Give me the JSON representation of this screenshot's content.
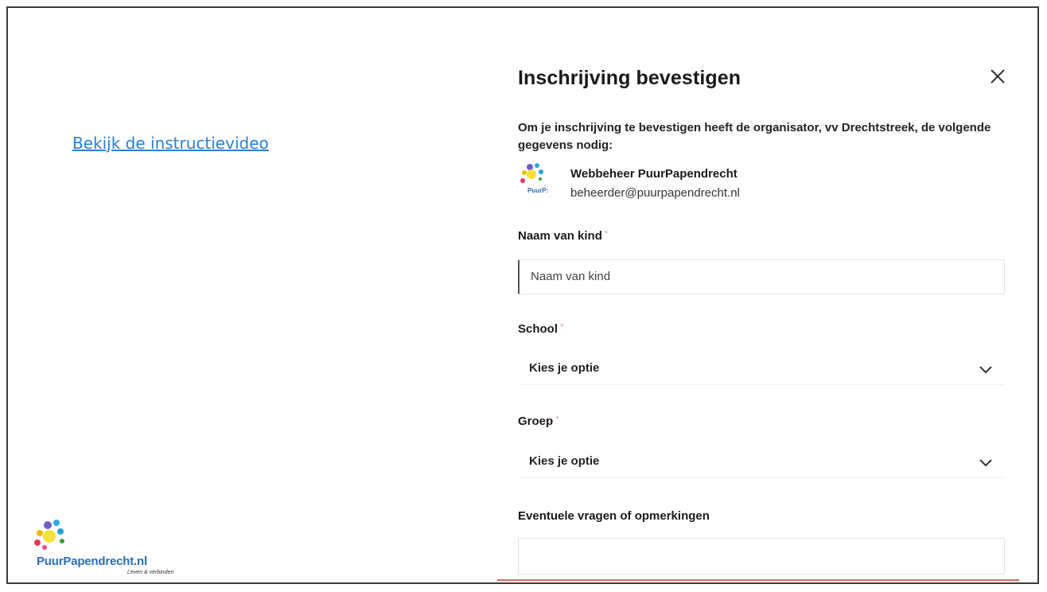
{
  "left": {
    "video_link": "Bekijk de instructievideo",
    "logo_text": "PuurPapendrecht.nl",
    "logo_tagline": "Leven & verbinden"
  },
  "modal": {
    "title": "Inschrijving bevestigen",
    "intro": "Om je inschrijving te bevestigen heeft de organisator, vv Drechtstreek, de volgende gegevens nodig:",
    "organizer": {
      "logo_text": "PuurP:",
      "name": "Webbeheer PuurPapendrecht",
      "email": "beheerder@puurpapendrecht.nl"
    },
    "fields": {
      "name": {
        "label": "Naam van kind",
        "required_mark": "*",
        "placeholder": "Naam van kind"
      },
      "school": {
        "label": "School",
        "required_mark": "*",
        "selected": "Kies je optie"
      },
      "group": {
        "label": "Groep",
        "required_mark": "*",
        "selected": "Kies je optie"
      },
      "remarks": {
        "label": "Eventuele vragen of opmerkingen"
      }
    }
  },
  "colors": {
    "link": "#2a7fd0",
    "accent_line": "#d96a5e"
  }
}
